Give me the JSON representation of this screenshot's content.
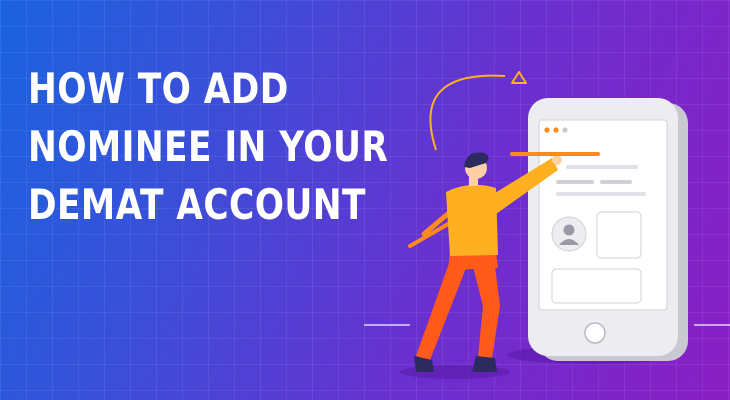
{
  "headline": {
    "line1": "HOW TO ADD",
    "line2": "NOMINEE IN YOUR",
    "line3": "DEMAT ACCOUNT"
  },
  "colors": {
    "gradient_start": "#1a63e0",
    "gradient_end": "#8a1fc4",
    "headline_text": "#ffffff",
    "accent_orange": "#ff8a1c",
    "shirt_yellow": "#ffb020",
    "pants_orange": "#ff5a1a",
    "phone_body": "#e9e9ee"
  },
  "icons": [
    "person-avatar-icon",
    "triangle-icon",
    "home-button-icon"
  ]
}
